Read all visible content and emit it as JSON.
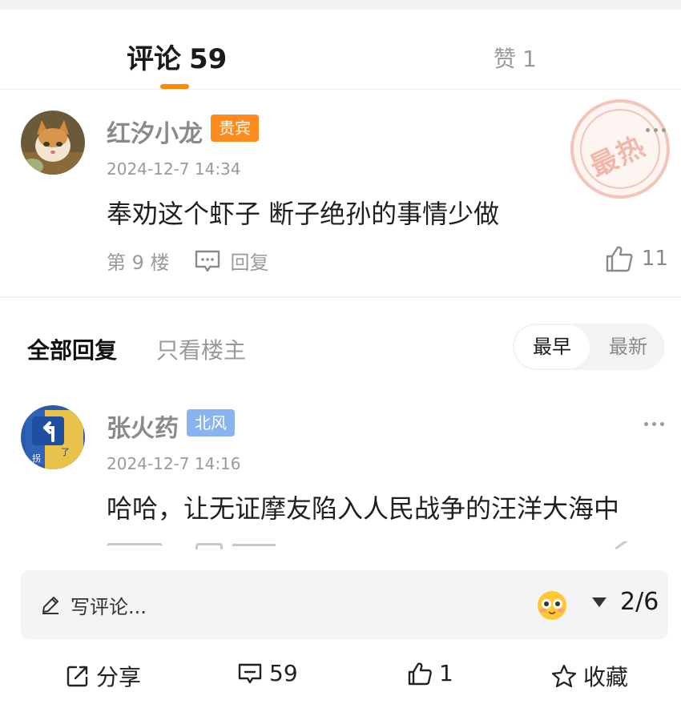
{
  "tabs": {
    "comments_label": "评论",
    "comments_count": "59",
    "likes_label": "赞",
    "likes_count": "1"
  },
  "main_comment": {
    "user": "红汐小龙",
    "badge": "贵宾",
    "time": "2024-12-7 14:34",
    "text": "奉劝这个虾子 断子绝孙的事情少做",
    "floor": "第 9 楼",
    "reply_label": "回复",
    "likes": "11",
    "stamp_text": "最热"
  },
  "filter": {
    "all_label": "全部回复",
    "owner_label": "只看楼主",
    "sort_options": [
      "最早",
      "最新"
    ],
    "sort_selected": "最早"
  },
  "replies": [
    {
      "user": "张火药",
      "badge": "北风",
      "time": "2024-12-7 14:16",
      "text": "哈哈，让无证摩友陷入人民战争的汪洋大海中",
      "avatar_text": "拐 了 拐 了"
    }
  ],
  "composer": {
    "placeholder": "写评论...",
    "page_indicator": "2/6"
  },
  "bottom_bar": {
    "share_label": "分享",
    "comments_count": "59",
    "likes_count": "1",
    "favorite_label": "收藏"
  },
  "colors": {
    "accent": "#ff8a00",
    "vip_badge": "#ff8a1f",
    "wind_badge": "#8ab4f0"
  }
}
